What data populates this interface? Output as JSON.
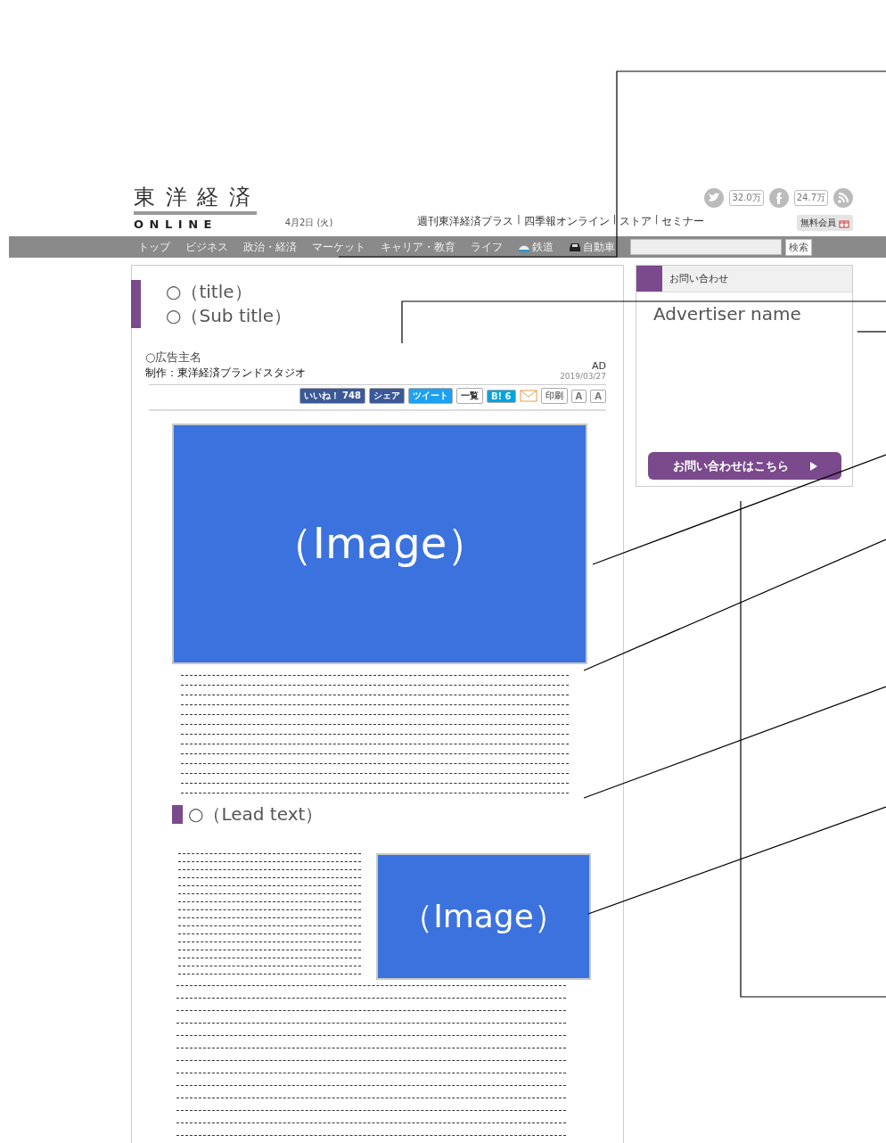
{
  "header": {
    "logo_title": "東 洋 経 済",
    "logo_subtitle": "O N L I N E",
    "date": "4月2日 (火)",
    "links": [
      "週刊東洋経済プラス",
      "|",
      "四季報オンライン",
      "|",
      "ストア",
      "|",
      "セミナー"
    ],
    "social": [
      {
        "kind": "twitter",
        "count": "32.0万"
      },
      {
        "kind": "facebook",
        "count": "24.7万"
      },
      {
        "kind": "rss"
      }
    ],
    "member_button": "無料会員"
  },
  "nav": {
    "items": [
      {
        "label": "トップ",
        "kind": "plain"
      },
      {
        "label": "ビジネス",
        "kind": "plain"
      },
      {
        "label": "政治・経済",
        "kind": "plain"
      },
      {
        "label": "マーケット",
        "kind": "plain"
      },
      {
        "label": "キャリア・教育",
        "kind": "plain"
      },
      {
        "label": "ライフ",
        "kind": "plain"
      },
      {
        "label": "鉄道",
        "kind": "rail"
      },
      {
        "label": "自動車",
        "kind": "car"
      }
    ],
    "search_button": "検索"
  },
  "article": {
    "title": "○（title）",
    "subtitle": "○（Sub title）",
    "advertiser": "○広告主名",
    "credit": "制作：東洋経済ブランドスタジオ",
    "ad_label": "AD",
    "date": "2019/03/27",
    "share": [
      {
        "label": "いいね！ 748",
        "kind": "like"
      },
      {
        "label": "シェア",
        "kind": "fb"
      },
      {
        "label": "ツイート",
        "kind": "tweet"
      },
      {
        "label": "一覧",
        "kind": "count"
      },
      {
        "label": "B! 6",
        "kind": "hatena"
      },
      {
        "kind": "mail"
      },
      {
        "label": "印刷",
        "kind": "small"
      },
      {
        "label": "A",
        "kind": "small"
      },
      {
        "label": "A",
        "kind": "small"
      }
    ],
    "main_image_label": "（Image）",
    "lead": "○（Lead text）",
    "side_image_label": "（Image）"
  },
  "sidebar": {
    "heading": "お問い合わせ",
    "advertiser": "Advertiser name",
    "button": "お問い合わせはこちら"
  }
}
